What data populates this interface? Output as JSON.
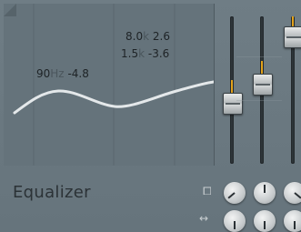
{
  "plugin": {
    "title": "Equalizer"
  },
  "display": {
    "bands": [
      {
        "freq": "90",
        "unit": "Hz",
        "gain": "-4.8"
      },
      {
        "freq": "8.0",
        "unit": "k",
        "gain": "2.6"
      },
      {
        "freq": "1.5",
        "unit": "k",
        "gain": "-3.6"
      }
    ]
  },
  "faders": [
    {
      "name": "band-1",
      "level": 0.4
    },
    {
      "name": "band-2",
      "level": 0.55
    },
    {
      "name": "band-3",
      "level": 0.92
    }
  ],
  "controls": {
    "type_icon": "band-type-icon",
    "width_icon": "band-width-icon"
  },
  "colors": {
    "accent": "#e3a21b",
    "curve": "#e4e8ea"
  }
}
